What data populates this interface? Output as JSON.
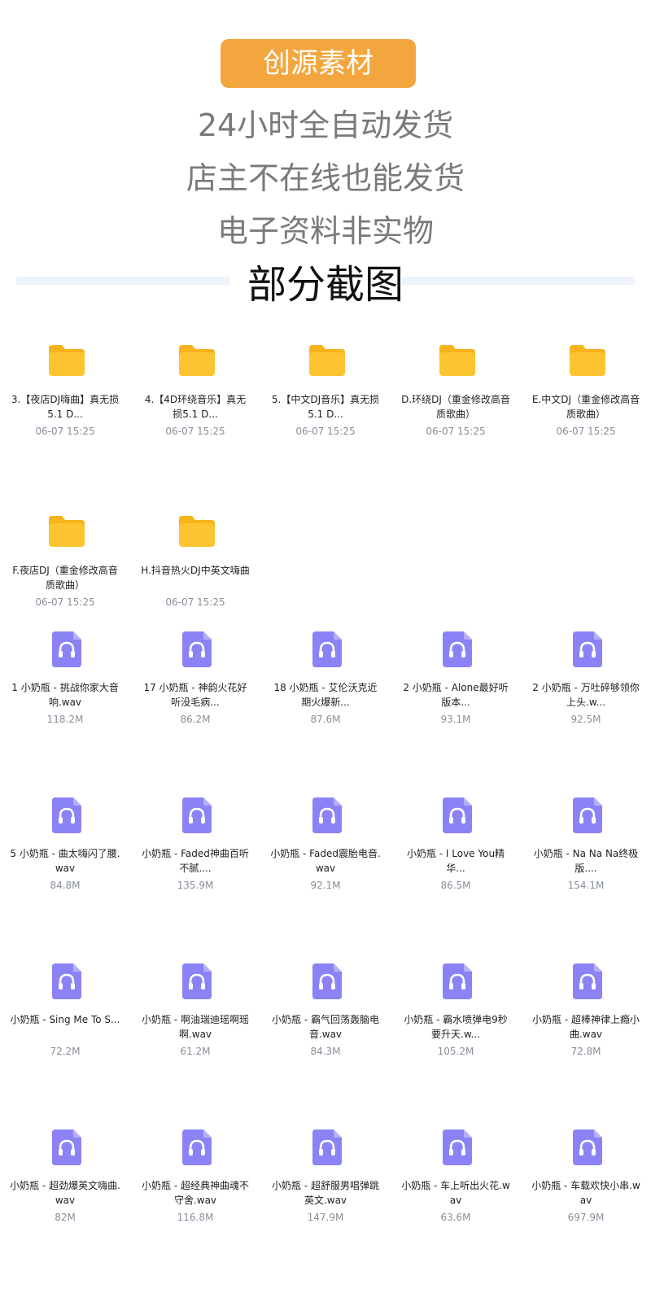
{
  "header": {
    "badge": "创源素材",
    "line1": "24小时全自动发货",
    "line2": "店主不在线也能发货",
    "line3": "电子资料非实物",
    "section_title": "部分截图"
  },
  "colors": {
    "badge_bg": "#f4a63e",
    "folder_yellow": "#fcc430",
    "audio_purple": "#8b83f5"
  },
  "folders": [
    {
      "name": "3.【夜店DJ嗨曲】真无损5.1 D...",
      "date": "06-07 15:25"
    },
    {
      "name": "4.【4D环绕音乐】真无损5.1 D...",
      "date": "06-07 15:25"
    },
    {
      "name": "5.【中文DJ音乐】真无损5.1 D...",
      "date": "06-07 15:25"
    },
    {
      "name": "D.环绕DJ（重金修改高音质歌曲）",
      "date": "06-07 15:25"
    },
    {
      "name": "E.中文DJ（重金修改高音质歌曲）",
      "date": "06-07 15:25"
    },
    {
      "name": "F.夜店DJ（重金修改高音质歌曲）",
      "date": "06-07 15:25"
    },
    {
      "name": "H.抖音热火DJ中英文嗨曲",
      "date": "06-07 15:25"
    }
  ],
  "files": [
    {
      "name": "1 小奶瓶 - 挑战你家大音响.wav",
      "size": "118.2M"
    },
    {
      "name": "17 小奶瓶 - 神韵火花好听没毛病...",
      "size": "86.2M"
    },
    {
      "name": "18 小奶瓶 - 艾伦沃克近期火爆新...",
      "size": "87.6M"
    },
    {
      "name": "2 小奶瓶 - Alone最好听版本...",
      "size": "93.1M"
    },
    {
      "name": "2 小奶瓶 - 万吐碎够领你上头.w...",
      "size": "92.5M"
    },
    {
      "name": "5 小奶瓶 - 曲太嗨闪了腰.wav",
      "size": "84.8M"
    },
    {
      "name": "小奶瓶 - Faded神曲百听不腻....",
      "size": "135.9M"
    },
    {
      "name": "小奶瓶 - Faded震胎电音.wav",
      "size": "92.1M"
    },
    {
      "name": "小奶瓶 - I Love You精华...",
      "size": "86.5M"
    },
    {
      "name": "小奶瓶 - Na Na Na终极版....",
      "size": "154.1M"
    },
    {
      "name": "小奶瓶 - Sing Me To S...",
      "size": "72.2M"
    },
    {
      "name": "小奶瓶 - 啊油瑞迪瑶啊瑶啊.wav",
      "size": "61.2M"
    },
    {
      "name": "小奶瓶 - 霸气回荡轰脑电音.wav",
      "size": "84.3M"
    },
    {
      "name": "小奶瓶 - 霸水喷弹电9秒要升天.w...",
      "size": "105.2M"
    },
    {
      "name": "小奶瓶 - 超棒神律上瘾小曲.wav",
      "size": "72.8M"
    },
    {
      "name": "小奶瓶 - 超劲爆英文嗨曲.wav",
      "size": "82M"
    },
    {
      "name": "小奶瓶 - 超经典神曲魂不守舍.wav",
      "size": "116.8M"
    },
    {
      "name": "小奶瓶 - 超舒服男唱弹跳英文.wav",
      "size": "147.9M"
    },
    {
      "name": "小奶瓶 - 车上听出火花.wav",
      "size": "63.6M"
    },
    {
      "name": "小奶瓶 - 车载欢快小串.wav",
      "size": "697.9M"
    }
  ]
}
